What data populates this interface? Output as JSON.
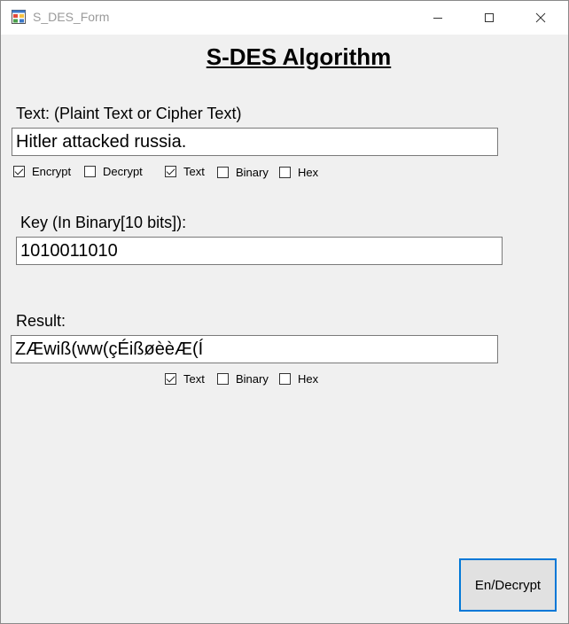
{
  "window": {
    "title": "S_DES_Form"
  },
  "heading": "S-DES Algorithm",
  "text_section": {
    "label": "Text: (Plaint Text or Cipher Text)",
    "value": "Hitler attacked russia.",
    "options": [
      {
        "label": "Encrypt",
        "checked": true
      },
      {
        "label": "Decrypt",
        "checked": false
      },
      {
        "label": "Text",
        "checked": true
      },
      {
        "label": "Binary",
        "checked": false
      },
      {
        "label": "Hex",
        "checked": false
      }
    ]
  },
  "key_section": {
    "label": "Key (In Binary[10 bits]):",
    "value": "1010011010"
  },
  "result_section": {
    "label": "Result:",
    "value": "ZÆwiß(ww(çÉißøèèÆ(Í",
    "options": [
      {
        "label": "Text",
        "checked": true
      },
      {
        "label": "Binary",
        "checked": false
      },
      {
        "label": "Hex",
        "checked": false
      }
    ]
  },
  "action_button": {
    "label": "En/Decrypt"
  }
}
